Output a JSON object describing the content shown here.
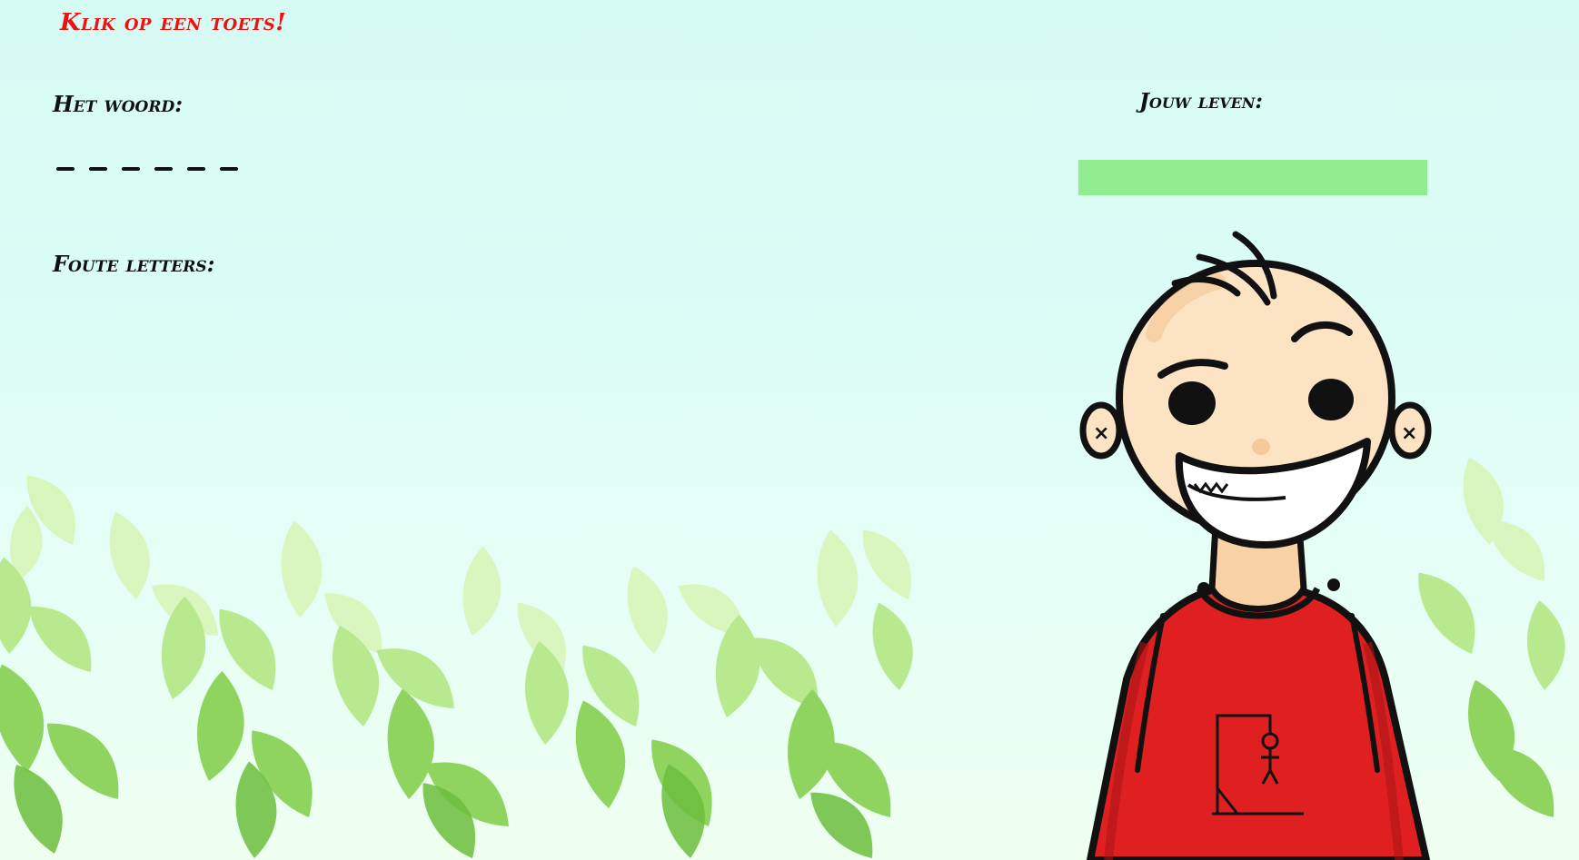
{
  "prompt": "Klik op een toets!",
  "word": {
    "label": "Het woord:",
    "slots": [
      "_",
      "_",
      "_",
      "_",
      "_",
      "_"
    ]
  },
  "wrong_letters": {
    "label": "Foute letters:",
    "letters": ""
  },
  "lives": {
    "label": "Jouw leven:",
    "fraction_remaining": 1.0,
    "bar_color": "#90ee90"
  },
  "character": {
    "icon": "smiling-boy-red-shirt-illustration",
    "shirt_color": "#e02020",
    "shirt_logo_icon": "hangman-gallows-icon"
  },
  "colors": {
    "prompt": "#ee1111",
    "text": "#111111",
    "sky": "#d6fbf4",
    "leaves": "#8fd45e"
  }
}
